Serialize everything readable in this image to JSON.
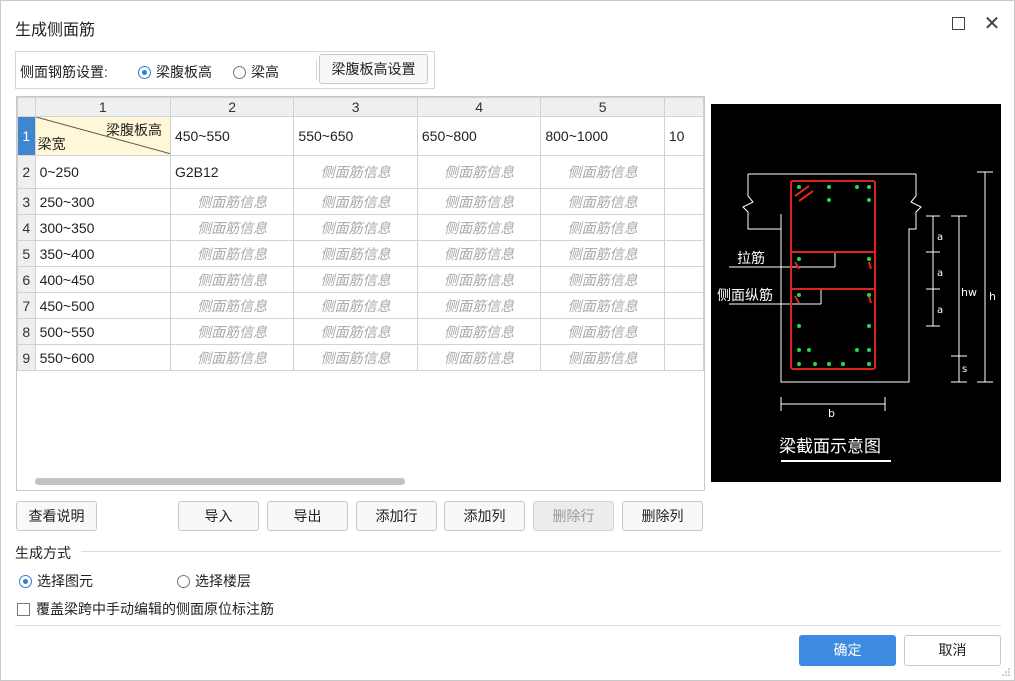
{
  "window": {
    "title": "生成侧面筋"
  },
  "settings": {
    "label": "侧面钢筋设置:",
    "options": [
      {
        "label": "梁腹板高",
        "selected": true
      },
      {
        "label": "梁高",
        "selected": false
      }
    ],
    "web_height_button": "梁腹板高设置"
  },
  "table": {
    "column_numbers": [
      "1",
      "2",
      "3",
      "4",
      "5",
      ""
    ],
    "row_numbers": [
      "1",
      "2",
      "3",
      "4",
      "5",
      "6",
      "7",
      "8",
      "9"
    ],
    "corner": {
      "top": "梁腹板高",
      "bottom": "梁宽"
    },
    "col_headers": [
      "450~550",
      "550~650",
      "650~800",
      "800~1000",
      "10"
    ],
    "rows": [
      {
        "range": "0~250",
        "cells": [
          "G2B12",
          "侧面筋信息",
          "侧面筋信息",
          "侧面筋信息",
          ""
        ]
      },
      {
        "range": "250~300",
        "cells": [
          "侧面筋信息",
          "侧面筋信息",
          "侧面筋信息",
          "侧面筋信息",
          ""
        ]
      },
      {
        "range": "300~350",
        "cells": [
          "侧面筋信息",
          "侧面筋信息",
          "侧面筋信息",
          "侧面筋信息",
          ""
        ]
      },
      {
        "range": "350~400",
        "cells": [
          "侧面筋信息",
          "侧面筋信息",
          "侧面筋信息",
          "侧面筋信息",
          ""
        ]
      },
      {
        "range": "400~450",
        "cells": [
          "侧面筋信息",
          "侧面筋信息",
          "侧面筋信息",
          "侧面筋信息",
          ""
        ]
      },
      {
        "range": "450~500",
        "cells": [
          "侧面筋信息",
          "侧面筋信息",
          "侧面筋信息",
          "侧面筋信息",
          ""
        ]
      },
      {
        "range": "500~550",
        "cells": [
          "侧面筋信息",
          "侧面筋信息",
          "侧面筋信息",
          "侧面筋信息",
          ""
        ]
      },
      {
        "range": "550~600",
        "cells": [
          "侧面筋信息",
          "侧面筋信息",
          "侧面筋信息",
          "侧面筋信息",
          ""
        ]
      }
    ]
  },
  "diagram": {
    "caption": "梁截面示意图",
    "labels": {
      "tie": "拉筋",
      "side_bar": "侧面纵筋",
      "a": "a",
      "hw": "hw",
      "h": "h",
      "s": "s",
      "b": "b"
    },
    "colors": {
      "background": "#000000",
      "line": "#ffffff",
      "stirrup": "#e0231d",
      "bar": "#19e04a"
    }
  },
  "actions": {
    "help": "查看说明",
    "import": "导入",
    "export": "导出",
    "add_row": "添加行",
    "add_col": "添加列",
    "delete_row": "删除行",
    "delete_col": "删除列"
  },
  "generation": {
    "label": "生成方式",
    "options": [
      {
        "label": "选择图元",
        "selected": true
      },
      {
        "label": "选择楼层",
        "selected": false
      }
    ],
    "overwrite_label": "覆盖梁跨中手动编辑的侧面原位标注筋",
    "overwrite_checked": false
  },
  "footer": {
    "ok": "确定",
    "cancel": "取消"
  },
  "colors": {
    "accent": "#3d8be0",
    "selected_row_header": "#3f86d1",
    "corner_fill": "#fff8d8"
  }
}
